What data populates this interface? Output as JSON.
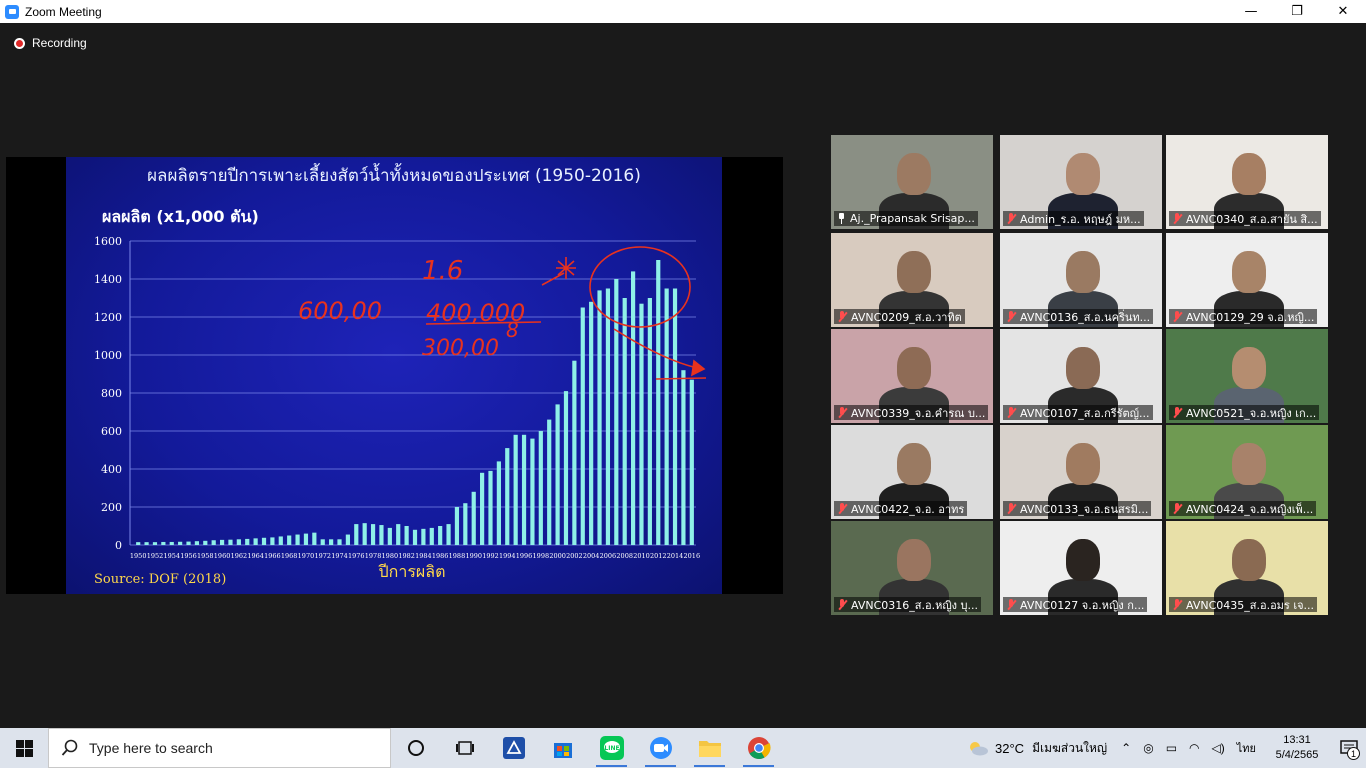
{
  "window": {
    "title": "Zoom Meeting",
    "minimize": "—",
    "maximize": "❐",
    "close": "✕"
  },
  "recording": {
    "label": "Recording"
  },
  "slide": {
    "title": "ผลผลิตรายปีการเพาะเลี้ยงสัตว์น้ำทั้งหมดของประเทศ (1950-2016)",
    "ylabel": "ผลผลิต (x1,000 ตัน)",
    "xlabel": "ปีการผลิต",
    "source": "Source: DOF (2018)",
    "annotations": [
      "1.6",
      "600,00",
      "400,000",
      "300,00",
      "8"
    ]
  },
  "chart_data": {
    "type": "bar",
    "title": "ผลผลิตรายปีการเพาะเลี้ยงสัตว์น้ำทั้งหมดของประเทศ (1950-2016)",
    "ylabel": "ผลผลิต (x1,000 ตัน)",
    "xlabel": "ปีการผลิต",
    "ylim": [
      0,
      1600
    ],
    "yticks": [
      0,
      200,
      400,
      600,
      800,
      1000,
      1200,
      1400,
      1600
    ],
    "grid": true,
    "tick_labels": [
      "1950",
      "1952",
      "1954",
      "1956",
      "1958",
      "1960",
      "1962",
      "1964",
      "1966",
      "1968",
      "1970",
      "1972",
      "1974",
      "1976",
      "1978",
      "1980",
      "1982",
      "1984",
      "1986",
      "1988",
      "1990",
      "1992",
      "1994",
      "1996",
      "1998",
      "2000",
      "2002",
      "2004",
      "2006",
      "2008",
      "2010",
      "2012",
      "2014",
      "2016"
    ],
    "x": [
      1950,
      1951,
      1952,
      1953,
      1954,
      1955,
      1956,
      1957,
      1958,
      1959,
      1960,
      1961,
      1962,
      1963,
      1964,
      1965,
      1966,
      1967,
      1968,
      1969,
      1970,
      1971,
      1972,
      1973,
      1974,
      1975,
      1976,
      1977,
      1978,
      1979,
      1980,
      1981,
      1982,
      1983,
      1984,
      1985,
      1986,
      1987,
      1988,
      1989,
      1990,
      1991,
      1992,
      1993,
      1994,
      1995,
      1996,
      1997,
      1998,
      1999,
      2000,
      2001,
      2002,
      2003,
      2004,
      2005,
      2006,
      2007,
      2008,
      2009,
      2010,
      2011,
      2012,
      2013,
      2014,
      2015,
      2016
    ],
    "values": [
      15,
      15,
      15,
      16,
      16,
      17,
      18,
      20,
      22,
      25,
      27,
      28,
      30,
      32,
      35,
      38,
      40,
      45,
      50,
      55,
      60,
      65,
      30,
      30,
      30,
      55,
      110,
      115,
      110,
      105,
      90,
      110,
      100,
      80,
      85,
      90,
      100,
      110,
      200,
      220,
      280,
      380,
      390,
      440,
      510,
      580,
      580,
      560,
      600,
      660,
      740,
      810,
      970,
      1250,
      1280,
      1340,
      1350,
      1400,
      1300,
      1440,
      1270,
      1300,
      1500,
      1350,
      1350,
      920,
      870
    ]
  },
  "participants": [
    {
      "name": "Aj._Prapansak  Srisap...",
      "pinned": true,
      "active": true,
      "muted": false,
      "bg": "#8a8f84",
      "skin": "#9c7a62",
      "shirt": "#2b2b2b"
    },
    {
      "name": "Admin_ร.อ. หฤษฎ์  มห...",
      "pinned": false,
      "active": false,
      "muted": true,
      "bg": "#d5d2cf",
      "skin": "#b08a72",
      "shirt": "#1e2230"
    },
    {
      "name": "AVNC0340_ส.อ.สายัน สิ...",
      "pinned": false,
      "active": false,
      "muted": true,
      "bg": "#ece9e4",
      "skin": "#a77f63",
      "shirt": "#2c2c2c"
    },
    {
      "name": "AVNC0209_ส.อ.วาทิต",
      "pinned": false,
      "active": false,
      "muted": true,
      "bg": "#d8cbbf",
      "skin": "#8f6f58",
      "shirt": "#343434"
    },
    {
      "name": "AVNC0136_ส.อ.นคริ่นท...",
      "pinned": false,
      "active": false,
      "muted": true,
      "bg": "#e6e6e6",
      "skin": "#9a7a62",
      "shirt": "#3a3f46"
    },
    {
      "name": "AVNC0129_29 จ.อ.หญิ...",
      "pinned": false,
      "active": false,
      "muted": true,
      "bg": "#eeeeee",
      "skin": "#a88468",
      "shirt": "#2a2a2a"
    },
    {
      "name": "AVNC0339_จ.อ.คำรณ บ...",
      "pinned": false,
      "active": false,
      "muted": true,
      "bg": "#c9a3a8",
      "skin": "#8e6b55",
      "shirt": "#3b3b3b"
    },
    {
      "name": "AVNC0107_ส.อ.กรีรัตญ์...",
      "pinned": false,
      "active": false,
      "muted": true,
      "bg": "#e4e4e4",
      "skin": "#8a6a55",
      "shirt": "#2a2a2a"
    },
    {
      "name": "AVNC0521_จ.อ.หญิง เก...",
      "pinned": false,
      "active": false,
      "muted": true,
      "bg": "#4f7a4a",
      "skin": "#b58d70",
      "shirt": "#5a6470"
    },
    {
      "name": "AVNC0422_จ.อ. อาทร",
      "pinned": false,
      "active": false,
      "muted": true,
      "bg": "#dcdcdc",
      "skin": "#9a7a62",
      "shirt": "#1f1f1f"
    },
    {
      "name": "AVNC0133_จ.อ.ธนสรมิ...",
      "pinned": false,
      "active": false,
      "muted": true,
      "bg": "#d8d2cc",
      "skin": "#a07b60",
      "shirt": "#242424"
    },
    {
      "name": "AVNC0424_จ.อ.หญิงเพ็...",
      "pinned": false,
      "active": false,
      "muted": true,
      "bg": "#6f9a52",
      "skin": "#a8826a",
      "shirt": "#4a4a4a"
    },
    {
      "name": "AVNC0316_ส.อ.หญิง บุ...",
      "pinned": false,
      "active": false,
      "muted": true,
      "bg": "#5a6a50",
      "skin": "#9a7560",
      "shirt": "#333333"
    },
    {
      "name": "AVNC0127 จ.อ.หญิง ก...",
      "pinned": false,
      "active": false,
      "muted": true,
      "bg": "#eeeeee",
      "skin": "#2a2420",
      "shirt": "#2a2a2a"
    },
    {
      "name": "AVNC0435_ส.อ.อมร  เจ...",
      "pinned": false,
      "active": false,
      "muted": true,
      "bg": "#e8e0a8",
      "skin": "#8a6a52",
      "shirt": "#303030"
    }
  ],
  "taskbar": {
    "search_placeholder": "Type here to search",
    "apps": [
      "task-view",
      "zoom-meeting-manager",
      "store",
      "line",
      "zoom",
      "file-explorer",
      "chrome"
    ],
    "weather": {
      "temp": "32°C",
      "desc": "มีเมฆส่วนใหญ่"
    },
    "language": "ไทย",
    "time": "13:31",
    "date": "5/4/2565",
    "notification_count": "1"
  }
}
